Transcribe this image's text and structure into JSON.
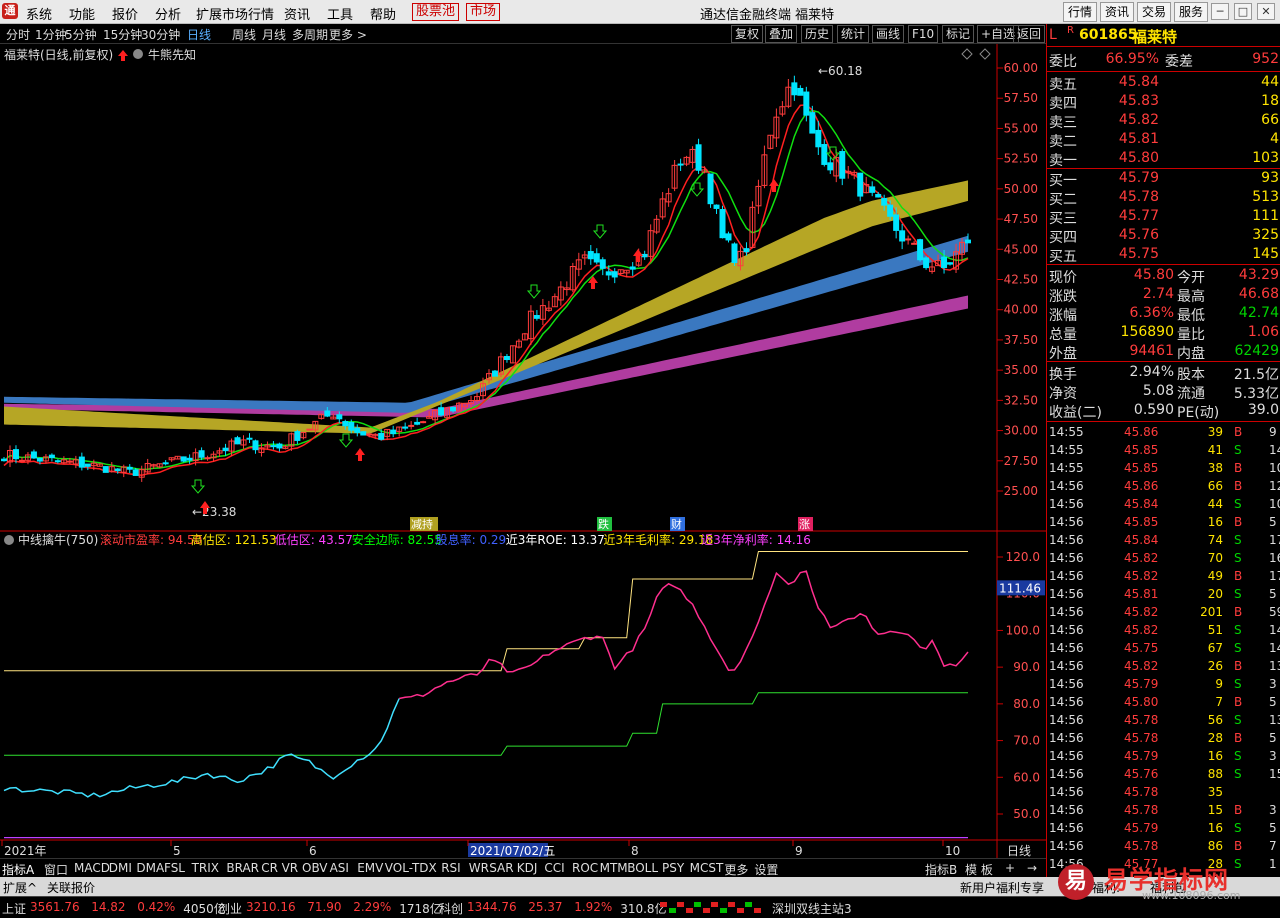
{
  "menubar": {
    "items": [
      "系统",
      "功能",
      "报价",
      "分析",
      "扩展市场行情",
      "资讯",
      "工具",
      "帮助"
    ],
    "boxed": [
      "股票池",
      "市场"
    ],
    "title": "通达信金融终端  福莱特",
    "right": [
      "行情",
      "资讯",
      "交易",
      "服务"
    ]
  },
  "periodbar": {
    "items": [
      "分时",
      "1分钟",
      "5分钟",
      "15分钟",
      "30分钟",
      "日线",
      "周线",
      "月线",
      "多周期",
      "更多 >"
    ],
    "active": "日线",
    "tools": [
      "复权",
      "叠加",
      "历史",
      "统计",
      "画线",
      "F10",
      "+自选",
      "返回"
    ],
    "tool_extra": "标记"
  },
  "main_chart": {
    "title": "福莱特(日线,前复权)",
    "subtitle": "牛熊先知",
    "y_ticks": [
      "60.00",
      "57.50",
      "55.00",
      "52.50",
      "50.00",
      "47.50",
      "45.00",
      "42.50",
      "40.00",
      "37.50",
      "35.00",
      "32.50",
      "30.00",
      "27.50",
      "25.00"
    ],
    "high_label": "60.18",
    "low_label": "23.38",
    "markers": [
      "减持",
      "跌",
      "财",
      "涨"
    ]
  },
  "indicator": {
    "name": "中线擒牛(750)",
    "fields": [
      {
        "label": "滚动市盈率: 94.50",
        "color": "#ff3c3c"
      },
      {
        "label": "高估区: 121.53",
        "color": "#ffe400"
      },
      {
        "label": "低估区: 43.57",
        "color": "#ff40ff"
      },
      {
        "label": "安全边际: 82.55",
        "color": "#00ff00"
      },
      {
        "label": "股息率: 0.29",
        "color": "#4060ff"
      },
      {
        "label": "近3年ROE: 13.37",
        "color": "#ffffff"
      },
      {
        "label": "近3年毛利率: 29.18",
        "color": "#ffe400"
      },
      {
        "label": "近3年净利率: 14.16",
        "color": "#ff40ff"
      }
    ],
    "y_ticks": [
      "120.0",
      "110.0",
      "100.0",
      "90.0",
      "80.0",
      "70.0",
      "60.0",
      "50.0"
    ],
    "current": "111.46"
  },
  "xaxis": {
    "labels": [
      "2021年",
      "5",
      "6",
      "2021/07/02/五",
      "8",
      "9",
      "10"
    ],
    "period": "日线"
  },
  "bottom_tabs": [
    "指标A",
    "窗口",
    "MACD",
    "DMI",
    "DMA",
    "FSL",
    "TRIX",
    "BRAR",
    "CR",
    "VR",
    "OBV",
    "ASI",
    "EMV",
    "VOL-TDX",
    "RSI",
    "WR",
    "SAR",
    "KDJ",
    "CCI",
    "ROC",
    "MTM",
    "BOLL",
    "PSY",
    "MCST",
    "更多",
    "设置"
  ],
  "bottom_right": [
    "指标B",
    "模 板",
    "+",
    "→"
  ],
  "extbar": {
    "left": [
      "扩展^",
      "关联报价"
    ],
    "right": [
      "新用户福利专享",
      "福利:",
      "福利包"
    ]
  },
  "statusbar": [
    {
      "name": "上证",
      "vals": [
        {
          "t": "3561.76",
          "c": "red"
        },
        {
          "t": "14.82",
          "c": "red"
        },
        {
          "t": "0.42%",
          "c": "red"
        },
        {
          "t": "4050亿",
          "c": "wht"
        }
      ]
    },
    {
      "name": "创业",
      "vals": [
        {
          "t": "3210.16",
          "c": "red"
        },
        {
          "t": "71.90",
          "c": "red"
        },
        {
          "t": "2.29%",
          "c": "red"
        },
        {
          "t": "1718亿",
          "c": "wht"
        }
      ]
    },
    {
      "name": "科创",
      "vals": [
        {
          "t": "1344.76",
          "c": "red"
        },
        {
          "t": "25.37",
          "c": "red"
        },
        {
          "t": "1.92%",
          "c": "red"
        },
        {
          "t": "310.8亿",
          "c": "wht"
        }
      ]
    }
  ],
  "status_right": "深圳双线主站3",
  "quote": {
    "code": "601865",
    "name": "福莱特",
    "prefix": "L",
    "badge": "R",
    "weibi": {
      "label": "委比",
      "val": "66.95%",
      "label2": "委差",
      "val2": "952"
    },
    "sell": [
      {
        "l": "卖五",
        "p": "45.84",
        "v": "44"
      },
      {
        "l": "卖四",
        "p": "45.83",
        "v": "18"
      },
      {
        "l": "卖三",
        "p": "45.82",
        "v": "66"
      },
      {
        "l": "卖二",
        "p": "45.81",
        "v": "4"
      },
      {
        "l": "卖一",
        "p": "45.80",
        "v": "103"
      }
    ],
    "buy": [
      {
        "l": "买一",
        "p": "45.79",
        "v": "93"
      },
      {
        "l": "买二",
        "p": "45.78",
        "v": "513"
      },
      {
        "l": "买三",
        "p": "45.77",
        "v": "111"
      },
      {
        "l": "买四",
        "p": "45.76",
        "v": "325"
      },
      {
        "l": "买五",
        "p": "45.75",
        "v": "145"
      }
    ],
    "stats": [
      {
        "l": "现价",
        "v": "45.80",
        "c": "red",
        "l2": "今开",
        "v2": "43.29",
        "c2": "red"
      },
      {
        "l": "涨跌",
        "v": "2.74",
        "c": "red",
        "l2": "最高",
        "v2": "46.68",
        "c2": "red"
      },
      {
        "l": "涨幅",
        "v": "6.36%",
        "c": "red",
        "l2": "最低",
        "v2": "42.74",
        "c2": "grn"
      },
      {
        "l": "总量",
        "v": "156890",
        "c": "yel",
        "l2": "量比",
        "v2": "1.06",
        "c2": "red"
      },
      {
        "l": "外盘",
        "v": "94461",
        "c": "red",
        "l2": "内盘",
        "v2": "62429",
        "c2": "grn"
      }
    ],
    "fin": [
      {
        "l": "换手",
        "v": "2.94%",
        "l2": "股本",
        "v2": "21.5亿"
      },
      {
        "l": "净资",
        "v": "5.08",
        "l2": "流通",
        "v2": "5.33亿"
      },
      {
        "l": "收益(二)",
        "v": "0.590",
        "l2": "PE(动)",
        "v2": "39.0"
      }
    ],
    "ticks": [
      {
        "t": "14:55",
        "p": "45.86",
        "v": "39",
        "bs": "B",
        "n": "9"
      },
      {
        "t": "14:55",
        "p": "45.85",
        "v": "41",
        "bs": "S",
        "n": "14"
      },
      {
        "t": "14:55",
        "p": "45.85",
        "v": "38",
        "bs": "B",
        "n": "10"
      },
      {
        "t": "14:56",
        "p": "45.86",
        "v": "66",
        "bs": "B",
        "n": "12"
      },
      {
        "t": "14:56",
        "p": "45.84",
        "v": "44",
        "bs": "S",
        "n": "10"
      },
      {
        "t": "14:56",
        "p": "45.85",
        "v": "16",
        "bs": "B",
        "n": "5"
      },
      {
        "t": "14:56",
        "p": "45.84",
        "v": "74",
        "bs": "S",
        "n": "17"
      },
      {
        "t": "14:56",
        "p": "45.82",
        "v": "70",
        "bs": "S",
        "n": "16"
      },
      {
        "t": "14:56",
        "p": "45.82",
        "v": "49",
        "bs": "B",
        "n": "17"
      },
      {
        "t": "14:56",
        "p": "45.81",
        "v": "20",
        "bs": "S",
        "n": "5"
      },
      {
        "t": "14:56",
        "p": "45.82",
        "v": "201",
        "bs": "B",
        "n": "59"
      },
      {
        "t": "14:56",
        "p": "45.82",
        "v": "51",
        "bs": "S",
        "n": "14"
      },
      {
        "t": "14:56",
        "p": "45.75",
        "v": "67",
        "bs": "S",
        "n": "14"
      },
      {
        "t": "14:56",
        "p": "45.82",
        "v": "26",
        "bs": "B",
        "n": "13"
      },
      {
        "t": "14:56",
        "p": "45.79",
        "v": "9",
        "bs": "S",
        "n": "3"
      },
      {
        "t": "14:56",
        "p": "45.80",
        "v": "7",
        "bs": "B",
        "n": "5"
      },
      {
        "t": "14:56",
        "p": "45.78",
        "v": "56",
        "bs": "S",
        "n": "13"
      },
      {
        "t": "14:56",
        "p": "45.78",
        "v": "28",
        "bs": "B",
        "n": "5"
      },
      {
        "t": "14:56",
        "p": "45.79",
        "v": "16",
        "bs": "S",
        "n": "3"
      },
      {
        "t": "14:56",
        "p": "45.76",
        "v": "88",
        "bs": "S",
        "n": "15"
      },
      {
        "t": "14:56",
        "p": "45.78",
        "v": "35",
        "bs": "",
        "n": ""
      },
      {
        "t": "14:56",
        "p": "45.78",
        "v": "15",
        "bs": "B",
        "n": "3"
      },
      {
        "t": "14:56",
        "p": "45.79",
        "v": "16",
        "bs": "S",
        "n": "5"
      },
      {
        "t": "14:56",
        "p": "45.78",
        "v": "86",
        "bs": "B",
        "n": "7"
      },
      {
        "t": "14:56",
        "p": "45.77",
        "v": "28",
        "bs": "S",
        "n": "1"
      }
    ]
  },
  "watermark": {
    "glyph": "易",
    "text": "易学指标网",
    "url": "www.108096.com"
  },
  "colors": {
    "up": "#ff3c3c",
    "down": "#00e5ff",
    "ma_red": "#ff2020",
    "ma_green": "#10e010",
    "band1": "#b6a625",
    "band2": "#3a78c0",
    "band3": "#b03ca0",
    "pe_line": "#ff2f8f",
    "pe_low": "#40e0ff",
    "high_zone": "#ffe480",
    "safe": "#2fe02f",
    "low_zone": "#c040ff"
  }
}
